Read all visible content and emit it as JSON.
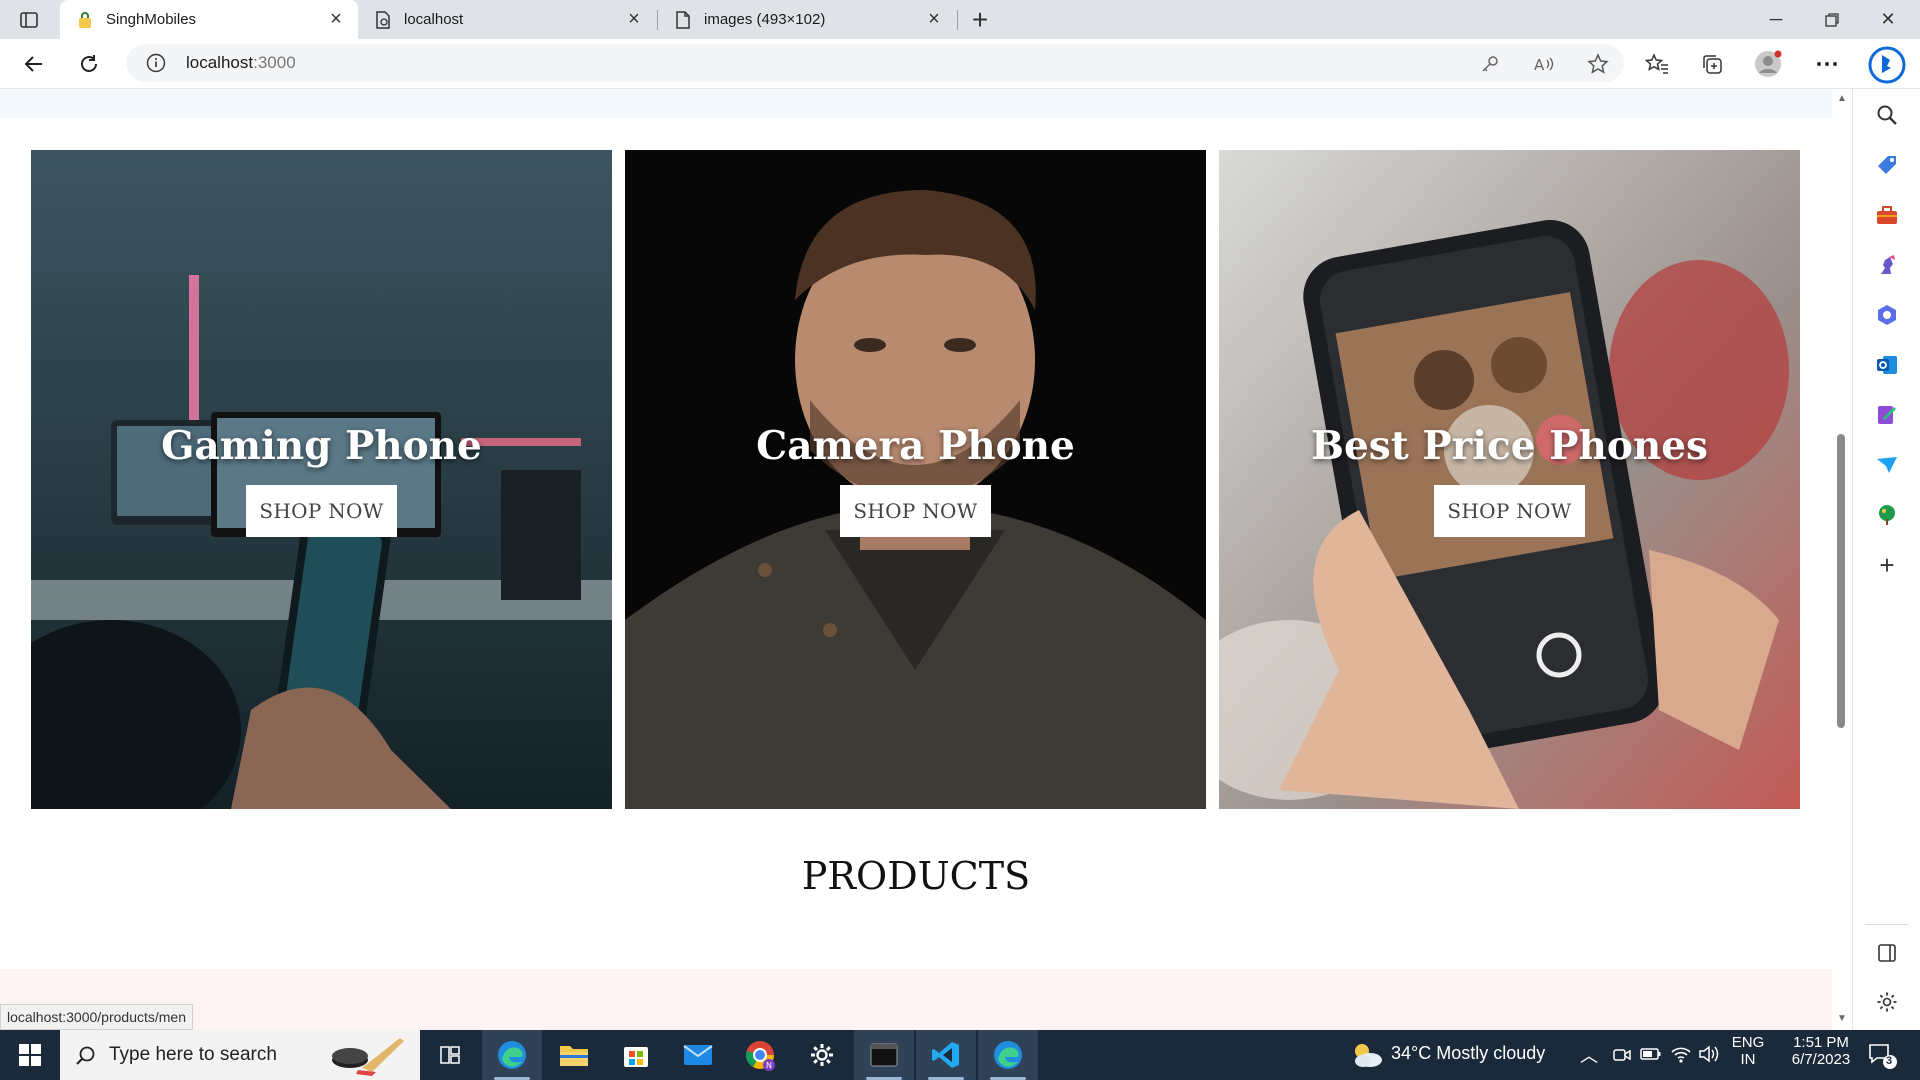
{
  "browser": {
    "tabs": [
      {
        "title": "SinghMobiles",
        "active": true
      },
      {
        "title": "localhost",
        "active": false
      },
      {
        "title": "images (493×102)",
        "active": false
      }
    ],
    "url_host": "localhost",
    "url_port": ":3000"
  },
  "page": {
    "cards": [
      {
        "title": "Gaming Phone",
        "button": "SHOP NOW"
      },
      {
        "title": "Camera Phone",
        "button": "SHOP NOW"
      },
      {
        "title": "Best Price Phones",
        "button": "SHOP NOW"
      }
    ],
    "products_heading": "PRODUCTS",
    "status_url": "localhost:3000/products/men"
  },
  "taskbar": {
    "search_placeholder": "Type here to search",
    "weather": "34°C  Mostly cloudy",
    "lang_top": "ENG",
    "lang_bottom": "IN",
    "time": "1:51 PM",
    "date": "6/7/2023",
    "notification_count": "3"
  },
  "colors": {
    "taskbar_bg": "#1b2a3a",
    "tabstrip_bg": "#dfe3e8",
    "page_top_strip": "#f3f8fc",
    "page_bottom_strip": "#fdf3f2",
    "edge_accent": "#0c6ad9"
  }
}
